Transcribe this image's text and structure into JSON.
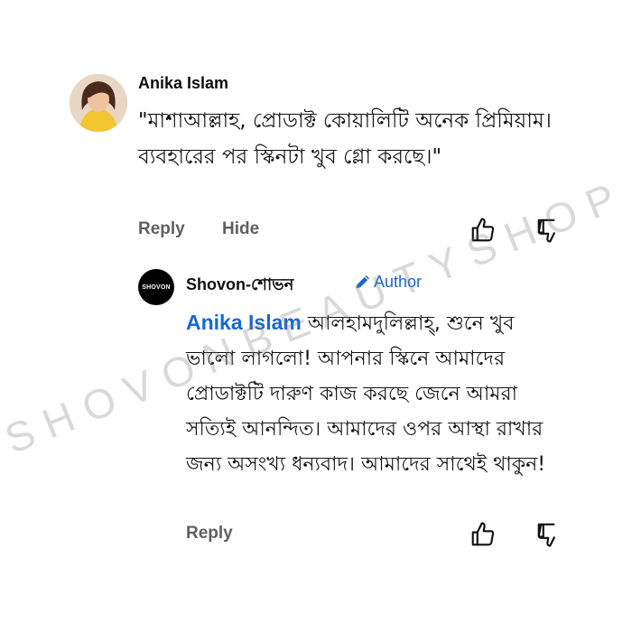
{
  "comment": {
    "author": "Anika Islam",
    "text": "\"মাশাআল্লাহ, প্রোডাক্ট কোয়ালিটি অনেক প্রিমিয়াম। ব্যবহারের পর স্কিনটা খুব গ্লো করছে।\"",
    "reply_label": "Reply",
    "hide_label": "Hide",
    "like_icon": "thumbs-up-icon",
    "dislike_icon": "thumbs-down-icon"
  },
  "reply": {
    "author": "Shovon-শোভন",
    "avatar_text": "SHOVON",
    "author_badge": "Author",
    "mention": "Anika Islam",
    "text": "আলহামদুলিল্লাহ্, শুনে খুব ভালো লাগলো! আপনার স্কিনে আমাদের প্রোডাক্টটি দারুণ কাজ করছে জেনে আমরা সত্যিই আনন্দিত। আমাদের ওপর আস্থা রাখার জন্য অসংখ্য ধন্যবাদ। আমাদের সাথেই থাকুন!",
    "reply_label": "Reply"
  },
  "watermark": "SHOVONBEAUTYSHOP",
  "colors": {
    "mention": "#1967d2",
    "action_gray": "#606060"
  }
}
